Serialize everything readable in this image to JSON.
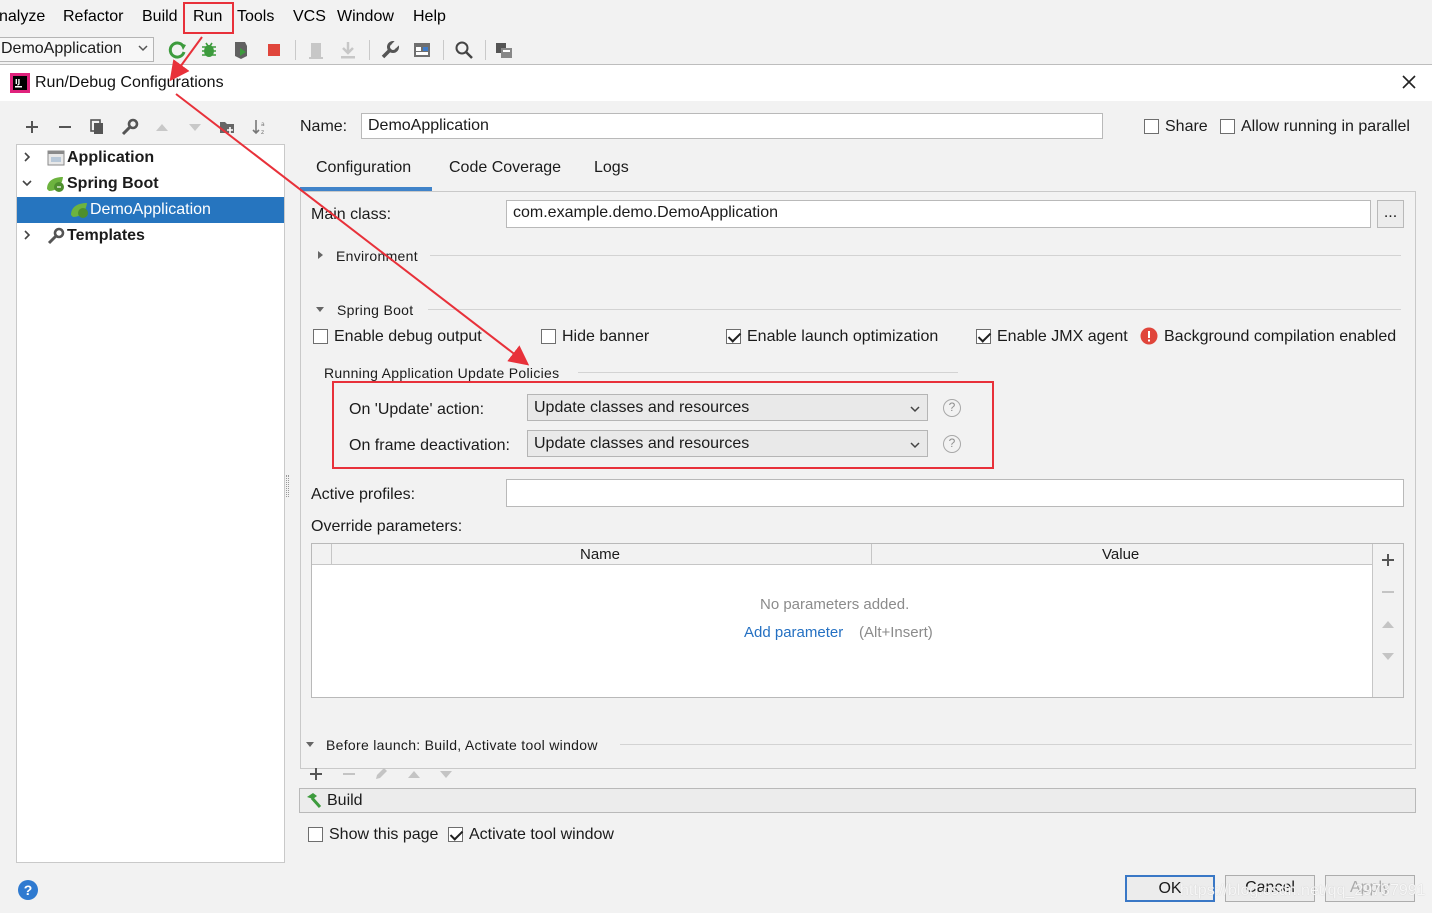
{
  "menubar": {
    "items": [
      {
        "label": "nalyze"
      },
      {
        "label": "Refactor"
      },
      {
        "label": "Build"
      },
      {
        "label": "Run"
      },
      {
        "label": "Tools"
      },
      {
        "label": "VCS"
      },
      {
        "label": "Window"
      },
      {
        "label": "Help"
      }
    ]
  },
  "toolbar": {
    "run_config": "DemoApplication"
  },
  "dialog": {
    "title": "Run/Debug Configurations",
    "tree": [
      {
        "label": "Application"
      },
      {
        "label": "Spring Boot"
      },
      {
        "label": "DemoApplication"
      },
      {
        "label": "Templates"
      }
    ],
    "name_label": "Name:",
    "name_value": "DemoApplication",
    "share_label": "Share",
    "parallel_label": "Allow running in parallel",
    "tabs": [
      "Configuration",
      "Code Coverage",
      "Logs"
    ],
    "main_class_label": "Main class:",
    "main_class_value": "com.example.demo.DemoApplication",
    "browse_label": "...",
    "environment_label": "Environment",
    "spring_boot_label": "Spring Boot",
    "checks": {
      "debug_output": "Enable debug output",
      "hide_banner": "Hide banner",
      "launch_opt": "Enable launch optimization",
      "jmx_agent": "Enable JMX agent",
      "bg_compile": "Background compilation enabled"
    },
    "update_policies_label": "Running Application Update Policies",
    "on_update_label": "On 'Update' action:",
    "on_update_value": "Update classes and resources",
    "on_frame_label": "On frame deactivation:",
    "on_frame_value": "Update classes and resources",
    "help_glyph": "?",
    "active_profiles_label": "Active profiles:",
    "override_label": "Override parameters:",
    "col_name": "Name",
    "col_value": "Value",
    "no_params": "No parameters added.",
    "add_param_link": "Add parameter",
    "add_param_hint": "(Alt+Insert)",
    "before_launch_label": "Before launch: Build, Activate tool window",
    "build_label": "Build",
    "show_page_label": "Show this page",
    "activate_label": "Activate tool window",
    "ok_label": "OK",
    "cancel_label": "Cancel",
    "apply_label": "Apply",
    "watermark": "https://blog.csdn.net/qq_29737991"
  },
  "colors": {
    "selection": "#2675bf",
    "annotation_red": "#e8313a",
    "link_blue": "#2470c2",
    "spring_green": "#6db33f"
  }
}
